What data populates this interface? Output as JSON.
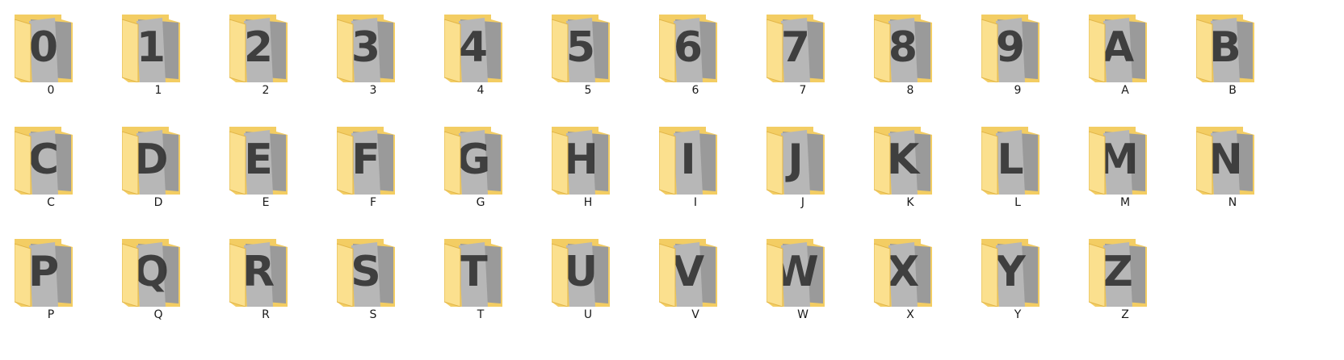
{
  "colors": {
    "folder_back": "#f3cd63",
    "folder_front": "#fbe08e",
    "folder_edge": "#e2b649",
    "sheet_back": "#9a9a9a",
    "sheet_front": "#b7b7b7",
    "glyph": "#2b2b2b"
  },
  "folders": [
    {
      "label": "0"
    },
    {
      "label": "1"
    },
    {
      "label": "2"
    },
    {
      "label": "3"
    },
    {
      "label": "4"
    },
    {
      "label": "5"
    },
    {
      "label": "6"
    },
    {
      "label": "7"
    },
    {
      "label": "8"
    },
    {
      "label": "9"
    },
    {
      "label": "A"
    },
    {
      "label": "B"
    },
    {
      "label": "C"
    },
    {
      "label": "D"
    },
    {
      "label": "E"
    },
    {
      "label": "F"
    },
    {
      "label": "G"
    },
    {
      "label": "H"
    },
    {
      "label": "I"
    },
    {
      "label": "J"
    },
    {
      "label": "K"
    },
    {
      "label": "L"
    },
    {
      "label": "M"
    },
    {
      "label": "N"
    },
    {
      "label": "P"
    },
    {
      "label": "Q"
    },
    {
      "label": "R"
    },
    {
      "label": "S"
    },
    {
      "label": "T"
    },
    {
      "label": "U"
    },
    {
      "label": "V"
    },
    {
      "label": "W"
    },
    {
      "label": "X"
    },
    {
      "label": "Y"
    },
    {
      "label": "Z"
    }
  ]
}
